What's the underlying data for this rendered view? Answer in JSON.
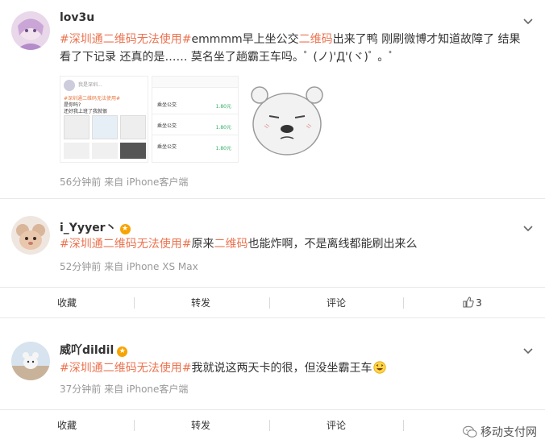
{
  "posts": [
    {
      "username": "lov3u",
      "content": {
        "topic": "#深圳通二维码无法使用#",
        "text_a": "emmmm早上坐公交",
        "highlight": "二维码",
        "text_b": "出来了鸭 刚刷微博才知道故障了 结果看了下记录 还真的是…… 莫名坐了趟霸王车吗。ﾟ (ノ)'Д'(ヾ)ﾟ 。ﾟ"
      },
      "images": [
        {
          "name": "screenshot-weibo-share",
          "small_text": [
            "我是深圳...",
            "#深圳通二维码无法使用#",
            "是你吗?",
            "还好我上班了我就很"
          ]
        },
        {
          "name": "screenshot-bus-records",
          "rows": [
            {
              "label": "乘坐公交",
              "amount": "1.80元"
            },
            {
              "label": "乘坐公交",
              "amount": "1.80元"
            },
            {
              "label": "乘坐公交",
              "amount": "1.80元"
            }
          ]
        },
        {
          "name": "bear-meme-sticker"
        }
      ],
      "meta": "56分钟前 来自 iPhone客户端"
    },
    {
      "username": "i_Yyyer丶",
      "content": {
        "topic": "#深圳通二维码无法使用#",
        "text_a": "原来",
        "highlight": "二维码",
        "text_b": "也能炸啊，不是离线都能刷出来么"
      },
      "meta": "52分钟前 来自 iPhone XS Max",
      "actions": {
        "favorite": "收藏",
        "repost": "转发",
        "comment": "评论",
        "like_count": "3"
      }
    },
    {
      "username": "威吖dildil",
      "content": {
        "topic": "#深圳通二维码无法使用#",
        "text_b": "我就说这两天卡的很，但没坐霸王车"
      },
      "meta": "37分钟前 来自 iPhone客户端",
      "actions": {
        "favorite": "收藏",
        "repost": "转发",
        "comment": "评论"
      }
    }
  ],
  "watermark": "移动支付网",
  "colors": {
    "topic": "#eb7350",
    "meta": "#999999",
    "divider": "#e8e8e8"
  }
}
